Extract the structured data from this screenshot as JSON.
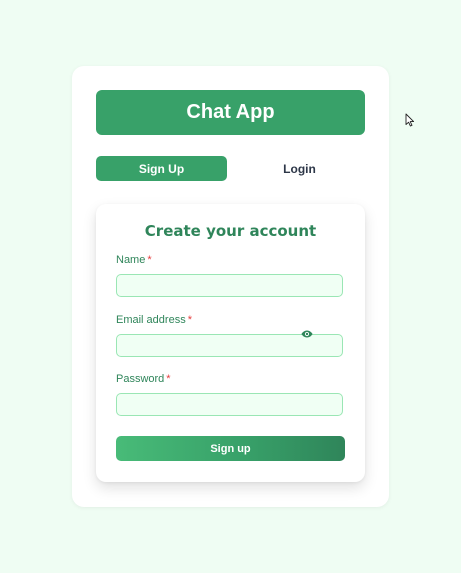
{
  "app": {
    "title": "Chat App"
  },
  "tabs": [
    {
      "label": "Sign Up",
      "active": true
    },
    {
      "label": "Login",
      "active": false
    }
  ],
  "form": {
    "title": "Create your account",
    "fields": {
      "name": {
        "label": "Name",
        "required_mark": "*",
        "value": "",
        "placeholder": ""
      },
      "email": {
        "label": "Email address",
        "required_mark": "*",
        "value": "",
        "placeholder": ""
      },
      "password": {
        "label": "Password",
        "required_mark": "*",
        "value": "",
        "placeholder": "",
        "toggle_icon": "eye-icon"
      }
    },
    "submit_label": "Sign up"
  },
  "colors": {
    "page_bg": "#effdf3",
    "primary": "#38a169",
    "primary_dark": "#2f855a",
    "input_bg": "#f0fff4",
    "input_border": "#9ae6b4",
    "required": "#e53e3e"
  }
}
